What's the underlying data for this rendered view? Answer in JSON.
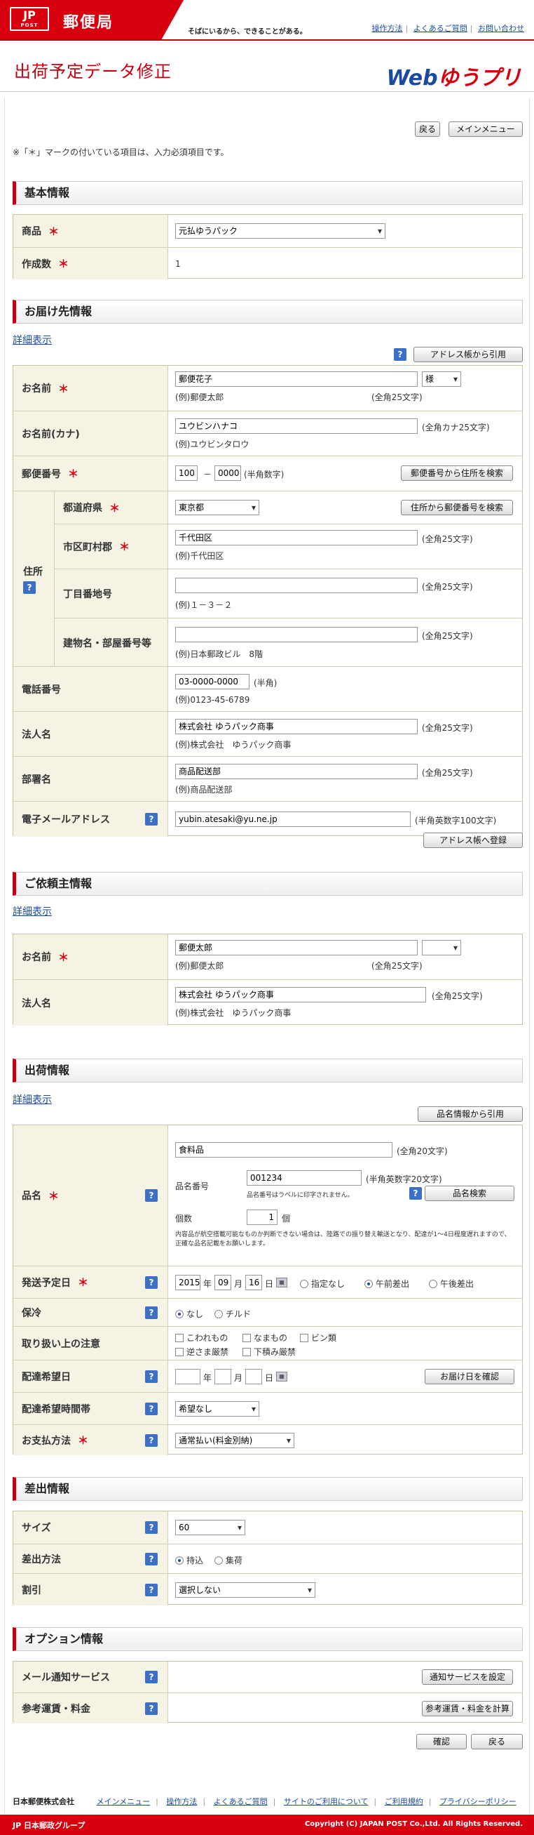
{
  "header": {
    "logo_mark": "JP",
    "logo_sub": "POST",
    "brand": "郵便局",
    "tagline": "そばにいるから、できることがある。",
    "links": [
      "操作方法",
      "よくあるご質問",
      "お問い合わせ"
    ],
    "page_title": "出荷予定データ修正",
    "product_logo_a": "Web",
    "product_logo_b": "ゆうプリ"
  },
  "top_buttons": {
    "back": "戻る",
    "main_menu": "メインメニュー"
  },
  "required_note": "※「＊」マークの付いている項目は、入力必須項目です。",
  "required_mark": "＊",
  "help_mark": "?",
  "basic": {
    "heading": "基本情報",
    "product_label": "商品",
    "product_value": "元払ゆうパック",
    "count_label": "作成数",
    "count_value": "1"
  },
  "recipient": {
    "heading": "お届け先情報",
    "detail_link": "詳細表示",
    "addressbook_button": "アドレス帳から引用",
    "name_label": "お名前",
    "name_value": "郵便花子",
    "honorific": "様",
    "name_example": "(例)郵便太郎",
    "name_hint": "(全角25文字)",
    "kana_label": "お名前(カナ)",
    "kana_value": "ユウビンハナコ",
    "kana_hint": "(全角カナ25文字)",
    "kana_example": "(例)ユウビンタロウ",
    "zip_label": "郵便番号",
    "zip1": "100",
    "zip_dash": "－",
    "zip2": "0000",
    "zip_hint": "(半角数字)",
    "zip_button": "郵便番号から住所を検索",
    "address_label": "住所",
    "pref_label": "都道府県",
    "pref_value": "東京都",
    "addr_button": "住所から郵便番号を検索",
    "city_label": "市区町村郡",
    "city_value": "千代田区",
    "city_hint": "(全角25文字)",
    "city_example": "(例)千代田区",
    "block_label": "丁目番地号",
    "block_value": "",
    "block_hint": "(全角25文字)",
    "block_example": "(例)１－３－２",
    "bldg_label": "建物名・部屋番号等",
    "bldg_value": "",
    "bldg_hint": "(全角25文字)",
    "bldg_example": "(例)日本郵政ビル　8階",
    "tel_label": "電話番号",
    "tel_value": "03-0000-0000",
    "tel_hint": "(半角)",
    "tel_example": "(例)0123-45-6789",
    "corp_label": "法人名",
    "corp_value": "株式会社 ゆうパック商事",
    "corp_hint": "(全角25文字)",
    "corp_example": "(例)株式会社　ゆうパック商事",
    "dept_label": "部署名",
    "dept_value": "商品配送部",
    "dept_hint": "(全角25文字)",
    "dept_example": "(例)商品配送部",
    "email_label": "電子メールアドレス",
    "email_value": "yubin.atesaki@yu.ne.jp",
    "email_hint": "(半角英数字100文字)",
    "register_button": "アドレス帳へ登録"
  },
  "sender": {
    "heading": "ご依頼主情報",
    "detail_link": "詳細表示",
    "name_label": "お名前",
    "name_value": "郵便太郎",
    "name_example": "(例)郵便太郎",
    "name_hint": "(全角25文字)",
    "corp_label": "法人名",
    "corp_value": "株式会社 ゆうパック商事",
    "corp_hint": "(全角25文字)",
    "corp_example": "(例)株式会社　ゆうパック商事"
  },
  "shipment": {
    "heading": "出荷情報",
    "detail_link": "詳細表示",
    "goods_button": "品名情報から引用",
    "item_label": "品名",
    "item_value": "食料品",
    "item_hint": "(全角20文字)",
    "code_label": "品名番号",
    "code_value": "001234",
    "code_hint": "(半角英数字20文字)",
    "code_note": "品名番号はラベルに印字されません。",
    "search_button": "品名検索",
    "qty_label": "個数",
    "qty_value": "1",
    "qty_unit": "個",
    "qty_note": "内容品が航空搭載可能なものか判断できない場合は、陸路での振り替え輸送となり、配達が1～4日程度遅れますので、正確な品名記載をお願いします。",
    "date_label": "発送予定日",
    "year": "2015",
    "year_unit": "年",
    "month": "09",
    "month_unit": "月",
    "day": "16",
    "day_unit": "日",
    "slot_options": [
      "指定なし",
      "午前差出",
      "午後差出"
    ],
    "cool_label": "保冷",
    "cool_options": [
      "なし",
      "チルド"
    ],
    "care_label": "取り扱い上の注意",
    "care_options": [
      "こわれもの",
      "なまもの",
      "ビン類",
      "逆さま厳禁",
      "下積み厳禁"
    ],
    "wish_label": "配達希望日",
    "wish_button": "お届け日を確認",
    "time_label": "配達希望時間帯",
    "time_value": "希望なし",
    "pay_label": "お支払方法",
    "pay_value": "通常払い(料金別納)"
  },
  "dispatch": {
    "heading": "差出情報",
    "size_label": "サイズ",
    "size_value": "60",
    "method_label": "差出方法",
    "method_options": [
      "持込",
      "集荷"
    ],
    "discount_label": "割引",
    "discount_value": "選択しない"
  },
  "options": {
    "heading": "オプション情報",
    "mail_label": "メール通知サービス",
    "mail_button": "通知サービスを設定",
    "fee_label": "参考運賃・料金",
    "fee_button": "参考運賃・料金を計算"
  },
  "bottom_buttons": {
    "confirm": "確認",
    "back": "戻る"
  },
  "footer": {
    "company": "日本郵便株式会社",
    "links": [
      "メインメニュー",
      "操作方法",
      "よくあるご質問",
      "サイトのご利用について",
      "ご利用規約",
      "プライバシーポリシー"
    ],
    "group": "日本郵政グループ",
    "copyright": "Copyright (C) JAPAN POST Co.,Ltd.  All Rights Reserved."
  }
}
